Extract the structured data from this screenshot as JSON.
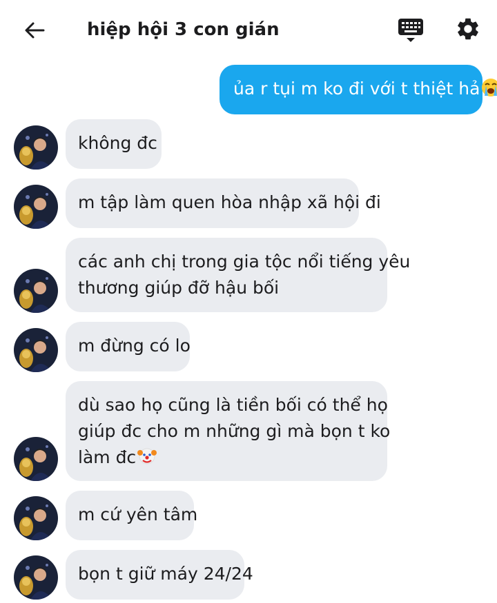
{
  "header": {
    "title": "hiệp hội 3 con gián"
  },
  "messages": [
    {
      "side": "out",
      "text": "ủa r tụi m ko đi với t thiệt hả",
      "emoji": "loudly-crying-face"
    },
    {
      "side": "in",
      "text": "không đc"
    },
    {
      "side": "in",
      "text": "m tập làm quen hòa nhập xã hội đi"
    },
    {
      "side": "in",
      "line1": "các anh chị trong gia tộc nổi tiếng yêu",
      "line2": "thương giúp đỡ hậu bối"
    },
    {
      "side": "in",
      "text": "m đừng có lo"
    },
    {
      "side": "in",
      "line1": "dù sao họ cũng là tiền bối có thể họ",
      "line2": "giúp đc cho m những gì mà bọn t ko",
      "line3": "làm đc",
      "emoji": "clown-face"
    },
    {
      "side": "in",
      "text": "m cứ yên tâm"
    },
    {
      "side": "in",
      "text": "bọn t giữ máy 24/24"
    }
  ],
  "colors": {
    "outgoing_bubble": "#1aa7ee",
    "incoming_bubble": "#eaecf0"
  }
}
